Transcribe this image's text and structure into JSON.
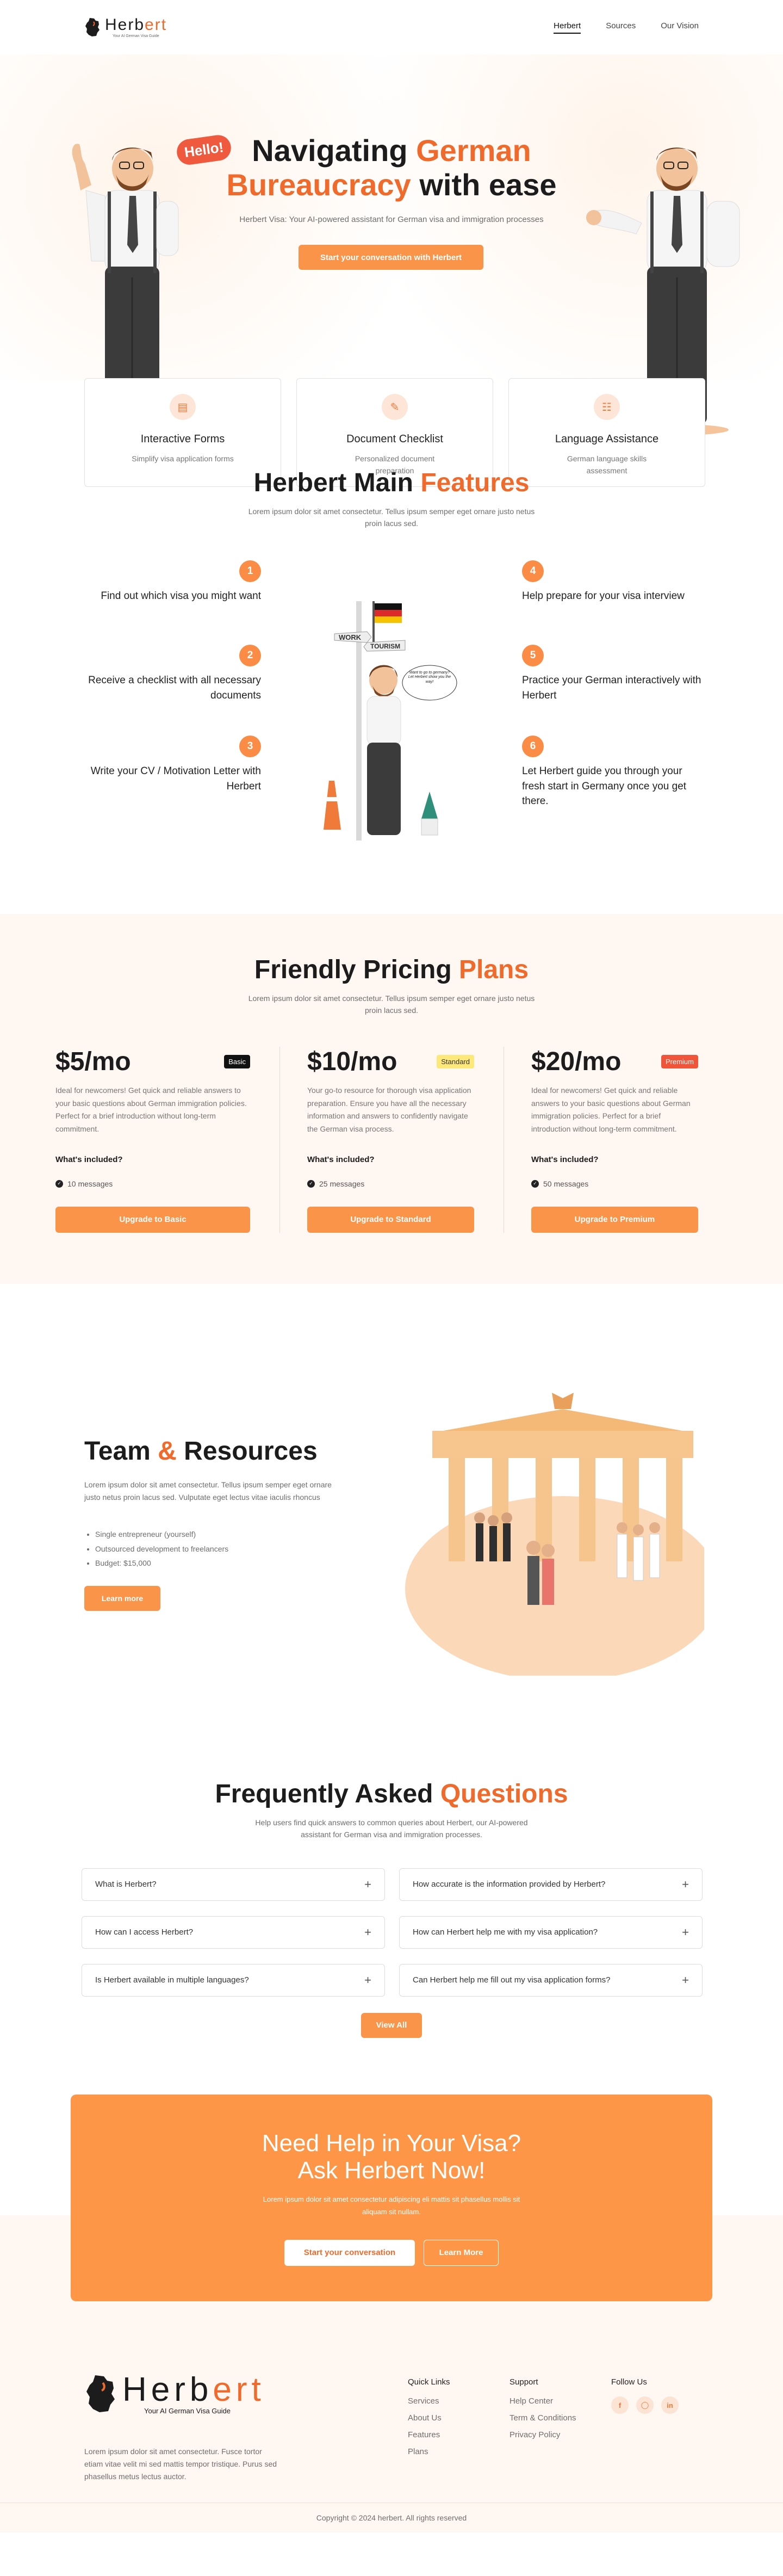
{
  "brand": {
    "word_a": "Herb",
    "word_b": "ert",
    "tagline": "Your AI German Visa Guide"
  },
  "nav": {
    "links": [
      "Herbert",
      "Sources",
      "Our Vision"
    ]
  },
  "hero": {
    "hello": "Hello!",
    "title_a": "Navigating ",
    "title_b": "German",
    "title_c": "Bureaucracy",
    "title_d": " with ease",
    "subtitle": "Herbert Visa: Your AI-powered assistant for German visa and immigration processes",
    "cta": "Start your conversation with Herbert"
  },
  "feature_cards": [
    {
      "title": "Interactive Forms",
      "desc": "Simplify visa application forms",
      "icon": "form-icon"
    },
    {
      "title": "Document Checklist",
      "desc": "Personalized document preparation",
      "icon": "document-icon"
    },
    {
      "title": "Language Assistance",
      "desc": "German language skills assessment",
      "icon": "translate-icon"
    }
  ],
  "features": {
    "title_a": "Herbert Main ",
    "title_b": "Features",
    "subtitle": "Lorem ipsum dolor sit amet consectetur. Tellus ipsum semper eget ornare justo netus proin lacus sed.",
    "items": [
      {
        "n": "1",
        "text": "Find out which visa you might want"
      },
      {
        "n": "2",
        "text": "Receive a checklist with all necessary documents"
      },
      {
        "n": "3",
        "text": "Write your CV / Motivation Letter with Herbert"
      },
      {
        "n": "4",
        "text": "Help prepare for your visa interview"
      },
      {
        "n": "5",
        "text": "Practice your German interactively with Herbert"
      },
      {
        "n": "6",
        "text": "Let Herbert guide you through your fresh start in Germany once you get there."
      }
    ],
    "sign_work": "WORK",
    "sign_tourism": "TOURISM",
    "bubble": "Want to go to germany? Let Herbert show you the way!"
  },
  "pricing": {
    "title_a": "Friendly Pricing ",
    "title_b": "Plans",
    "subtitle": "Lorem ipsum dolor sit amet consectetur. Tellus ipsum semper eget ornare justo netus proin lacus sed.",
    "plans": [
      {
        "price": "$5/mo",
        "badge": "Basic",
        "badge_bg": "#111111",
        "badge_fg": "#ffffff",
        "desc": "Ideal for newcomers! Get quick and reliable answers to your basic questions about German immigration policies. Perfect for a brief introduction without long-term commitment.",
        "included": "What's included?",
        "messages": "10 messages",
        "button": "Upgrade to Basic"
      },
      {
        "price": "$10/mo",
        "badge": "Standard",
        "badge_bg": "#fde87a",
        "badge_fg": "#333333",
        "desc": "Your go-to resource for thorough visa application preparation. Ensure you have all the necessary information and answers to confidently navigate the German visa process.",
        "included": "What's included?",
        "messages": "25 messages",
        "button": "Upgrade to Standard"
      },
      {
        "price": "$20/mo",
        "badge": "Premium",
        "badge_bg": "#f0553a",
        "badge_fg": "#ffffff",
        "desc": "Ideal for newcomers! Get quick and reliable answers to your basic questions about German immigration policies. Perfect for a brief introduction without long-term commitment.",
        "included": "What's included?",
        "messages": "50 messages",
        "button": "Upgrade to Premium"
      }
    ]
  },
  "team": {
    "title_a": "Team ",
    "title_amp": "&",
    "title_b": " Resources",
    "text": "Lorem ipsum dolor sit amet consectetur. Tellus ipsum semper eget ornare justo netus proin lacus sed. Vulputate eget lectus vitae iaculis rhoncus",
    "list": [
      "Single entrepreneur (yourself)",
      "Outsourced development to freelancers",
      "Budget: $15,000"
    ],
    "button": "Learn more"
  },
  "faq": {
    "title_a": "Frequently Asked ",
    "title_b": "Questions",
    "subtitle": "Help users find quick answers to common queries about Herbert, our AI-powered assistant for German visa and immigration processes.",
    "items": [
      "What is Herbert?",
      "How accurate is the information provided by Herbert?",
      "How can I access Herbert?",
      "How can Herbert help me with my visa application?",
      "Is Herbert available in multiple languages?",
      "Can Herbert help me fill out my visa application forms?"
    ],
    "view_all": "View All"
  },
  "cta": {
    "line1": "Need Help in Your Visa?",
    "line2": "Ask Herbert Now!",
    "text": "Lorem ipsum dolor sit amet consectetur adipiscing eli mattis sit phasellus mollis sit aliquam sit nullam.",
    "primary": "Start your conversation",
    "secondary": "Learn More"
  },
  "footer": {
    "text": "Lorem ipsum dolor sit amet consectetur. Fusce tortor etiam vitae velit mi sed mattis tempor tristique. Purus sed phasellus metus lectus auctor.",
    "quick_title": "Quick Links",
    "quick": [
      "Services",
      "About Us",
      "Features",
      "Plans"
    ],
    "support_title": "Support",
    "support": [
      "Help Center",
      "Term & Conditions",
      "Privacy Policy"
    ],
    "follow_title": "Follow Us",
    "copyright": "Copyright © 2024 herbert. All rights reserved"
  },
  "colors": {
    "accent": "#fa9448",
    "accent_text": "#f06a2b",
    "soft_bg": "#fff7f2"
  }
}
